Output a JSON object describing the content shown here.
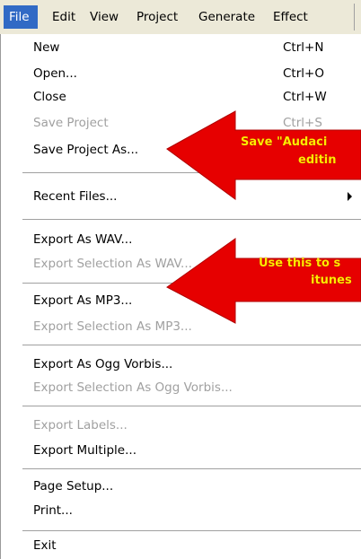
{
  "menubar": {
    "items": [
      "File",
      "Edit",
      "View",
      "Project",
      "Generate",
      "Effect"
    ]
  },
  "menu": {
    "new": {
      "label": "New",
      "shortcut": "Ctrl+N"
    },
    "open": {
      "label": "Open...",
      "shortcut": "Ctrl+O"
    },
    "close": {
      "label": "Close",
      "shortcut": "Ctrl+W"
    },
    "save_project": {
      "label": "Save Project",
      "shortcut": "Ctrl+S"
    },
    "save_project_as": {
      "label": "Save Project As..."
    },
    "recent_files": {
      "label": "Recent Files..."
    },
    "export_wav": {
      "label": "Export As WAV..."
    },
    "export_selection_wav": {
      "label": "Export Selection As WAV..."
    },
    "export_mp3": {
      "label": "Export As MP3..."
    },
    "export_selection_mp3": {
      "label": "Export Selection As MP3..."
    },
    "export_ogg": {
      "label": "Export As Ogg Vorbis..."
    },
    "export_selection_ogg": {
      "label": "Export Selection As Ogg Vorbis..."
    },
    "export_labels": {
      "label": "Export Labels..."
    },
    "export_multiple": {
      "label": "Export Multiple..."
    },
    "page_setup": {
      "label": "Page Setup..."
    },
    "print": {
      "label": "Print..."
    },
    "exit": {
      "label": "Exit"
    }
  },
  "annotations": {
    "save_callout_line1": "Save \"Audaci",
    "save_callout_line2": "editin",
    "mp3_callout_line1": "Use this to s",
    "mp3_callout_line2": "itunes",
    "arrow_color": "#e60000",
    "text_color": "#ffea00"
  },
  "colors": {
    "menubar_bg": "#ECE9D8",
    "active_menu_bg": "#316AC5",
    "disabled_text": "#a0a0a0"
  }
}
